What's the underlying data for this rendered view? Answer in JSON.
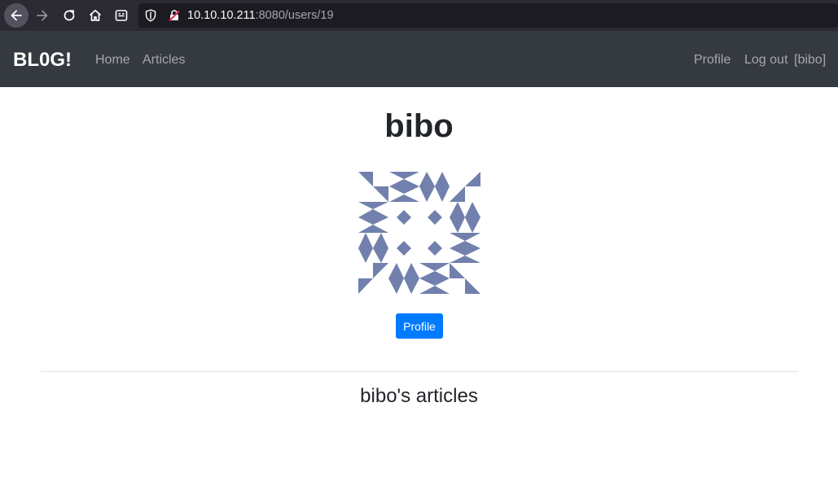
{
  "browser": {
    "url_host": "10.10.10.211",
    "url_path": ":8080/users/19"
  },
  "navbar": {
    "brand": "BL0G!",
    "links": [
      "Home",
      "Articles"
    ],
    "right_links": [
      "Profile",
      "Log out",
      "[bibo]"
    ]
  },
  "profile": {
    "username": "bibo",
    "avatar_color": "#7180ac",
    "button_label": "Profile",
    "button_color": "#007bff"
  },
  "articles": {
    "heading": "bibo's articles"
  }
}
